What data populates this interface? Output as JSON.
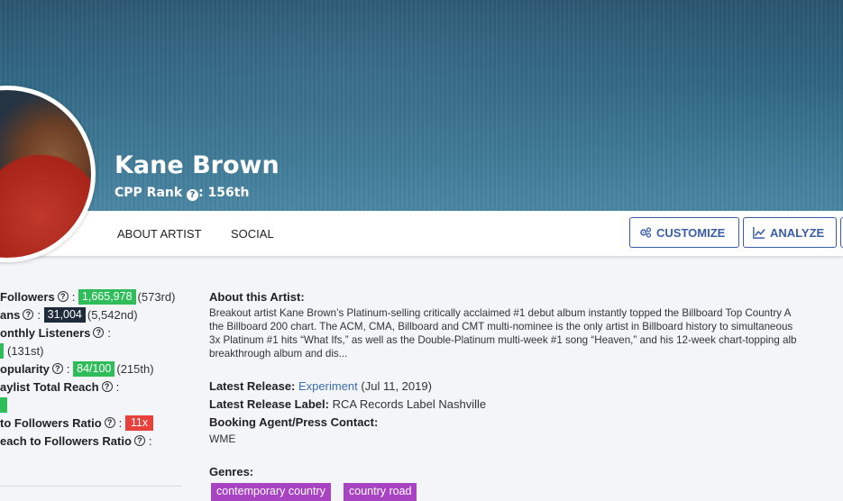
{
  "artist": {
    "name": "Kane Brown",
    "rank_label": "CPP Rank",
    "rank_value": "156th"
  },
  "nav": {
    "about": "ABOUT ARTIST",
    "social": "SOCIAL",
    "customize": "CUSTOMIZE",
    "analyze": "ANALYZE"
  },
  "stats": [
    {
      "label": "Followers",
      "value": "1,665,978",
      "rank": "(573rd)"
    },
    {
      "label": "ans",
      "value": "31,004",
      "rank": "(5,542nd)"
    },
    {
      "label": "onthly Listeners",
      "value": "",
      "rank": ""
    },
    {
      "label": "",
      "value": "",
      "rank": "(131st)"
    },
    {
      "label": "opularity",
      "value": "84/100",
      "rank": "(215th)"
    },
    {
      "label": "aylist Total Reach",
      "value": "",
      "rank": ""
    },
    {
      "label": "",
      "value": "",
      "rank": ""
    },
    {
      "label": "to Followers Ratio",
      "value": "11x",
      "rank": ""
    },
    {
      "label": "each to Followers Ratio",
      "value": "",
      "rank": ""
    }
  ],
  "about": {
    "title": "About this Artist:",
    "lines": [
      "Breakout artist Kane Brown’s Platinum-selling critically acclaimed #1 debut album instantly topped the Billboard Top Country A",
      "the Billboard 200 chart. The ACM, CMA, Billboard and CMT multi-nominee is the only artist in Billboard history to simultaneous",
      "3x Platinum #1 hits “What Ifs,” as well as the Double-Platinum multi-week #1 song “Heaven,” and his 12-week chart-topping alb",
      "breakthrough album and dis..."
    ],
    "latest_release_label": "Latest Release:",
    "latest_release_name": "Experiment",
    "latest_release_date": "(Jul 11, 2019)",
    "latest_label_label": "Latest Release Label:",
    "latest_label_value": "RCA Records Label Nashville",
    "booking_label": "Booking Agent/Press Contact:",
    "booking_value": "WME",
    "genres_label": "Genres:",
    "genres": [
      "contemporary country",
      "country road"
    ]
  },
  "colors": {
    "accent": "#3a5da8",
    "green": "#2ebd59",
    "dark": "#1f2b3a",
    "red": "#e8413c",
    "genre": "#a843c2"
  }
}
